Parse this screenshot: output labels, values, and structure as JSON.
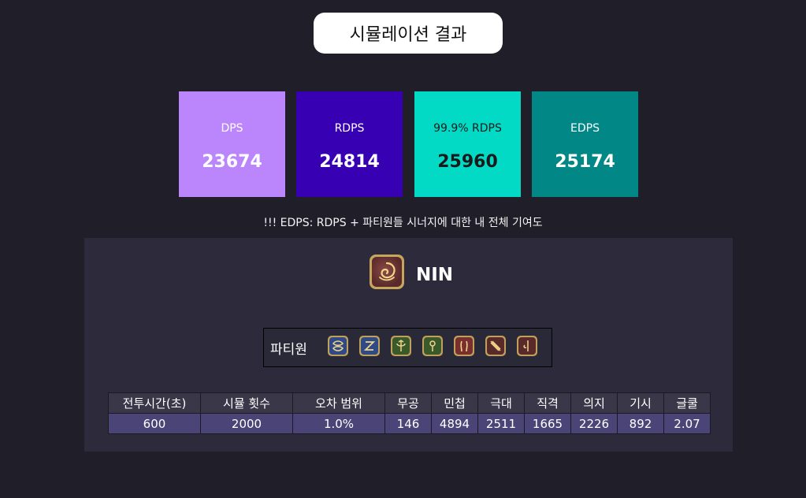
{
  "title": "시뮬레이션 결과",
  "colors": {
    "background": "#201f29",
    "panel": "#2d2b3b",
    "dps_card": "#bb86fc",
    "rdps_card": "#3700b3",
    "rdps999_card": "#03dac6",
    "edps_card": "#018786",
    "table_header": "#3a3748",
    "table_row": "#4b4476"
  },
  "cards": [
    {
      "label": "DPS",
      "value": "23674"
    },
    {
      "label": "RDPS",
      "value": "24814"
    },
    {
      "label": "99.9% RDPS",
      "value": "25960"
    },
    {
      "label": "EDPS",
      "value": "25174"
    }
  ],
  "note": "!!! EDPS: RDPS + 파티원들 시너지에 대한 내 전체 기여도",
  "job": {
    "name": "NIN",
    "icon": "ninja-job-icon"
  },
  "party": {
    "label": "파티원",
    "members": [
      {
        "icon": "paladin-job-icon"
      },
      {
        "icon": "dragoon-job-icon"
      },
      {
        "icon": "astrologian-job-icon"
      },
      {
        "icon": "sage-job-icon"
      },
      {
        "icon": "dancer-job-icon"
      },
      {
        "icon": "bard-job-icon"
      },
      {
        "icon": "red-mage-job-icon"
      }
    ]
  },
  "table": {
    "headers": [
      "전투시간(초)",
      "시뮬 횟수",
      "오차 범위",
      "무공",
      "민첩",
      "극대",
      "직격",
      "의지",
      "기시",
      "글쿨"
    ],
    "row": [
      "600",
      "2000",
      "1.0%",
      "146",
      "4894",
      "2511",
      "1665",
      "2226",
      "892",
      "2.07"
    ]
  }
}
